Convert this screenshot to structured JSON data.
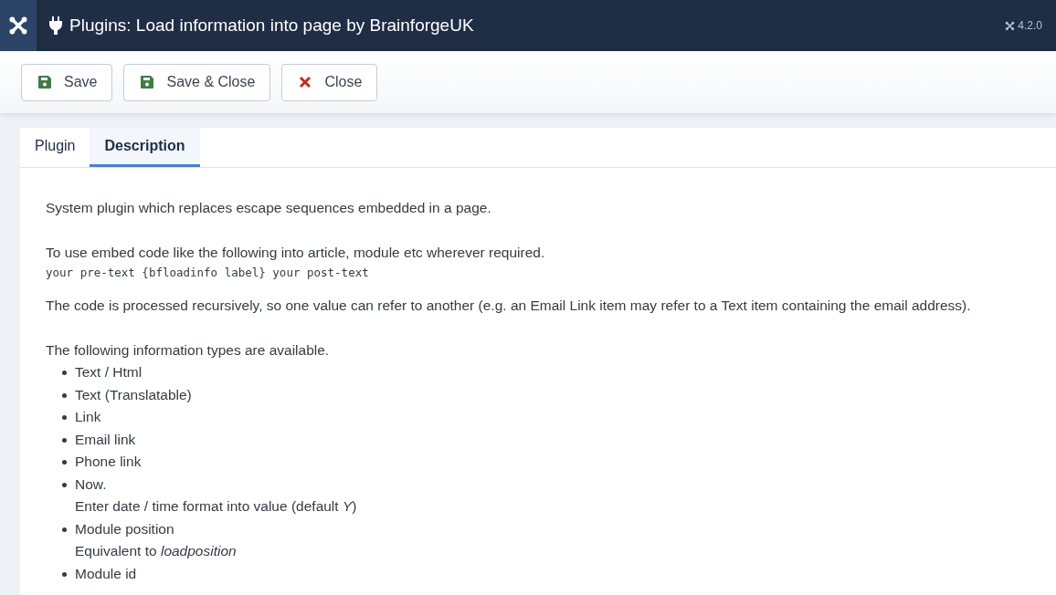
{
  "header": {
    "title": "Plugins: Load information into page by BrainforgeUK",
    "version": "4.2.0"
  },
  "toolbar": [
    {
      "label": "Save",
      "kind": "save"
    },
    {
      "label": "Save & Close",
      "kind": "save"
    },
    {
      "label": "Close",
      "kind": "close"
    }
  ],
  "tabs": [
    {
      "label": "Plugin",
      "selected": false
    },
    {
      "label": "Description",
      "selected": true
    }
  ],
  "description": {
    "intro": "System plugin which replaces escape sequences embedded in a page.",
    "usage": "To use embed code like the following into article, module etc wherever required.",
    "code": "your pre-text {bfloadinfo label} your post-text",
    "recursion": "The code is processed recursively, so one value can refer to another (e.g. an Email Link item may refer to a Text item containing the email address).",
    "types_heading": "The following information types are available.",
    "types": [
      {
        "label": "Text / Html"
      },
      {
        "label": "Text (Translatable)"
      },
      {
        "label": "Link"
      },
      {
        "label": "Email link"
      },
      {
        "label": "Phone link"
      },
      {
        "label": "Now.",
        "note": "Enter date / time format into value (default *Y*)"
      },
      {
        "label": "Module position",
        "note": "Equivalent to *loadposition*"
      },
      {
        "label": "Module id"
      }
    ]
  }
}
